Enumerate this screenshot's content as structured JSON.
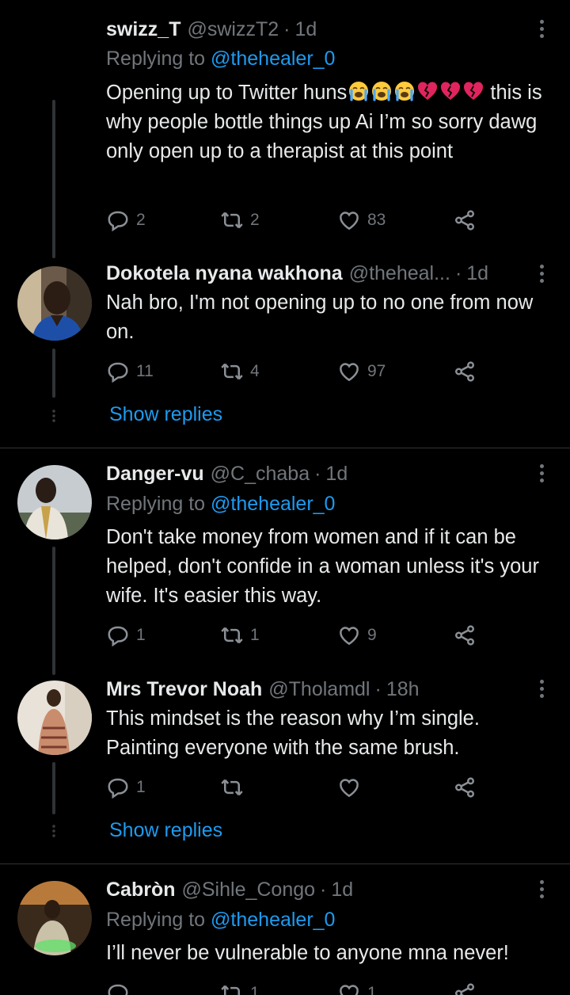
{
  "tweets": [
    {
      "name": "swizz_T",
      "handle": "@swizzT2",
      "time": "1d",
      "replying_prefix": "Replying to",
      "replying_to": "@thehealer_0",
      "text_lead": "Opening up to Twitter huns",
      "emojis": [
        "loudly-crying-face",
        "loudly-crying-face",
        "loudly-crying-face",
        "broken-heart",
        "broken-heart",
        "broken-heart"
      ],
      "text_rest": "this is why people bottle things up Ai I’m so sorry dawg only open up to a therapist at this point",
      "replies": "2",
      "retweets": "2",
      "likes": "83"
    },
    {
      "name": "Dokotela nyana wakhona",
      "handle": "@theheal...",
      "time": "1d",
      "text": "Nah bro, I'm not opening up to no one from now on.",
      "replies": "11",
      "retweets": "4",
      "likes": "97",
      "show_replies": "Show replies"
    },
    {
      "name": "Danger-vu",
      "handle": "@C_chaba",
      "time": "1d",
      "replying_prefix": "Replying to",
      "replying_to": "@thehealer_0",
      "text": "Don't take money from women and if it can be helped, don't confide in a woman unless it's your wife. It's easier this way.",
      "replies": "1",
      "retweets": "1",
      "likes": "9"
    },
    {
      "name": "Mrs Trevor Noah",
      "handle": "@Tholamdl",
      "time": "18h",
      "text": "This mindset is the reason why I’m single. Painting everyone with the same brush.",
      "replies": "1",
      "retweets": "",
      "likes": "",
      "show_replies": "Show replies"
    },
    {
      "name": "Cabròn",
      "handle": "@Sihle_Congo",
      "time": "1d",
      "replying_prefix": "Replying to",
      "replying_to": "@thehealer_0",
      "text": "I’ll never be vulnerable to anyone mna never!",
      "replies": "",
      "retweets": "1",
      "likes": "1"
    }
  ],
  "icons": {
    "reply": "reply-icon",
    "retweet": "retweet-icon",
    "like": "heart-icon",
    "share": "share-icon",
    "more": "more-options-icon"
  },
  "colors": {
    "background": "#000000",
    "text": "#e7e9ea",
    "secondary": "#71767b",
    "link": "#1d9bf0",
    "divider": "#2f3336"
  }
}
